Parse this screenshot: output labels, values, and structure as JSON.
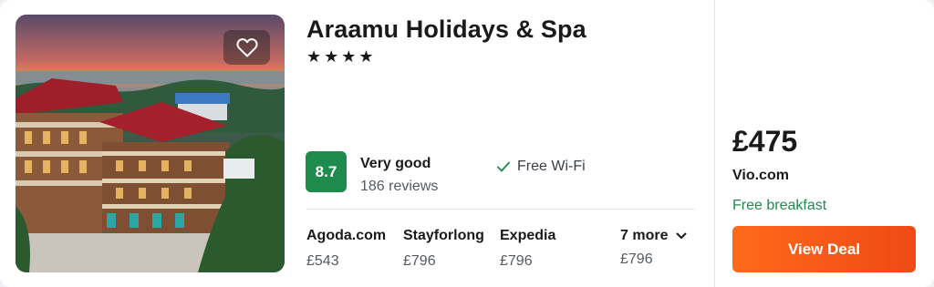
{
  "hotel": {
    "name": "Araamu Holidays & Spa",
    "stars": "★★★★",
    "score": "8.7",
    "rating_label": "Very good",
    "review_count": "186 reviews",
    "amenity": "Free Wi-Fi"
  },
  "providers": [
    {
      "name": "Agoda.com",
      "price": "£543"
    },
    {
      "name": "Stayforlong",
      "price": "£796"
    },
    {
      "name": "Expedia",
      "price": "£796"
    }
  ],
  "more_providers": {
    "label": "7 more",
    "price": "£796"
  },
  "deal": {
    "price": "£475",
    "provider": "Vio.com",
    "perk": "Free breakfast",
    "button_label": "View Deal"
  },
  "icons": {
    "favorite": "heart-outline-icon",
    "amenity": "check-icon",
    "more": "chevron-down-icon"
  },
  "colors": {
    "score_badge": "#1e8a4c",
    "perk_text": "#1e8a4c",
    "deal_button": "#f25a17"
  }
}
